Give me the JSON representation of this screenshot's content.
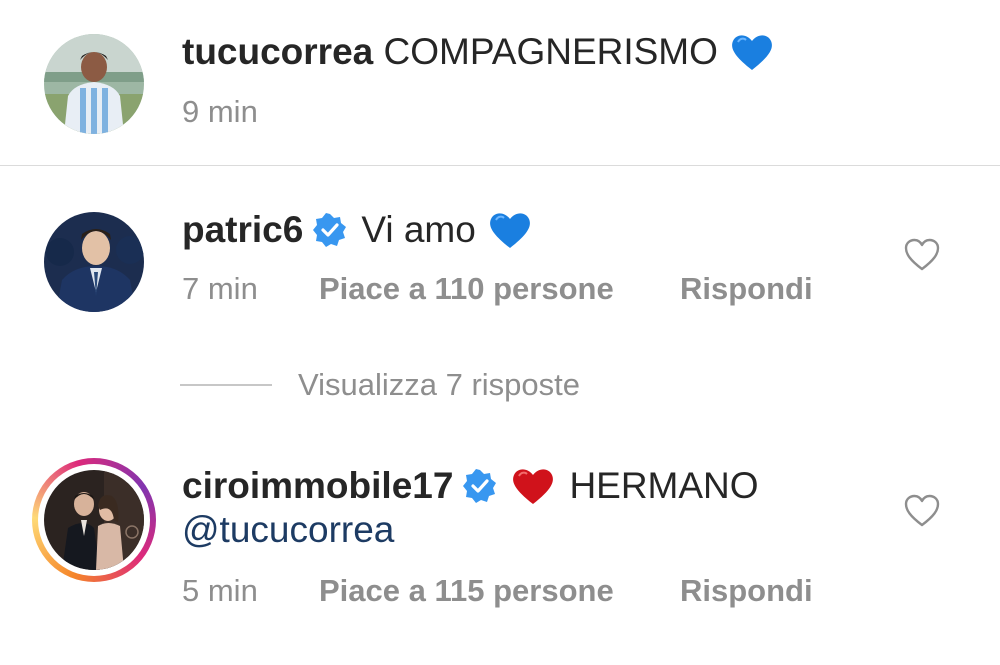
{
  "comments": [
    {
      "username": "tucucorrea",
      "text": "COMPAGNERISMO",
      "emoji": "blue-heart",
      "time": "9 min"
    },
    {
      "username": "patric6",
      "verified": true,
      "text": "Vi amo",
      "emoji": "blue-heart",
      "time": "7 min",
      "likes": "Piace a 110 persone",
      "reply": "Rispondi"
    },
    {
      "username": "ciroimmobile17",
      "verified": true,
      "emoji": "red-heart",
      "text": "HERMANO",
      "mention": "@tucucorrea",
      "time": "5 min",
      "likes": "Piace a 115 persone",
      "reply": "Rispondi",
      "story_ring": true
    }
  ],
  "view_replies": "Visualizza 7 risposte",
  "colors": {
    "text": "#262626",
    "meta": "#8e8e8e",
    "mention": "#1d3b63",
    "verified": "#3897f0",
    "blue_heart": "#1a7fe0",
    "red_heart": "#d0121b",
    "divider": "#dbdbdb"
  }
}
